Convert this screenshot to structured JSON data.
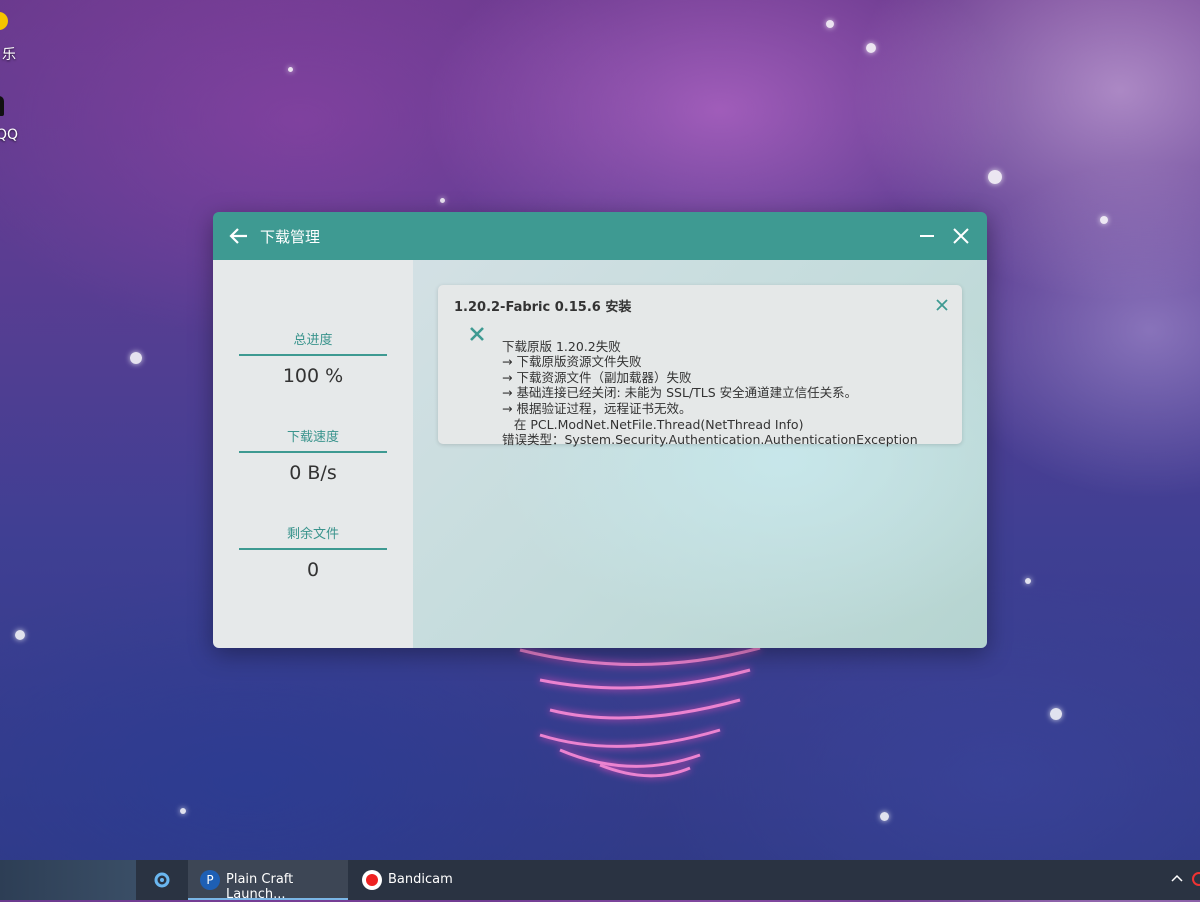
{
  "desktop": {
    "icons": [
      {
        "label": "乐"
      },
      {
        "label": "QQ"
      }
    ]
  },
  "window": {
    "title": "下载管理",
    "sidebar": {
      "stats": [
        {
          "label": "总进度",
          "value": "100 %"
        },
        {
          "label": "下载速度",
          "value": "0 B/s"
        },
        {
          "label": "剩余文件",
          "value": "0"
        }
      ]
    },
    "task": {
      "title": "1.20.2-Fabric 0.15.6 安装",
      "status": "failed",
      "lines": [
        "下载原版 1.20.2失败",
        "→ 下载原版资源文件失败",
        "→ 下载资源文件（副加载器）失败",
        "→ 基础连接已经关闭: 未能为 SSL/TLS 安全通道建立信任关系。",
        "→ 根据验证过程，远程证书无效。",
        "   在 PCL.ModNet.NetFile.Thread(NetThread Info)",
        "错误类型：System.Security.Authentication.AuthenticationException"
      ]
    },
    "accent_color": "#3e9a92"
  },
  "taskbar": {
    "apps": [
      {
        "label": "Plain Craft Launch...",
        "icon": "pcl-icon",
        "active": true
      },
      {
        "label": "Bandicam",
        "icon": "bandicam-record-icon",
        "active": false
      }
    ]
  }
}
